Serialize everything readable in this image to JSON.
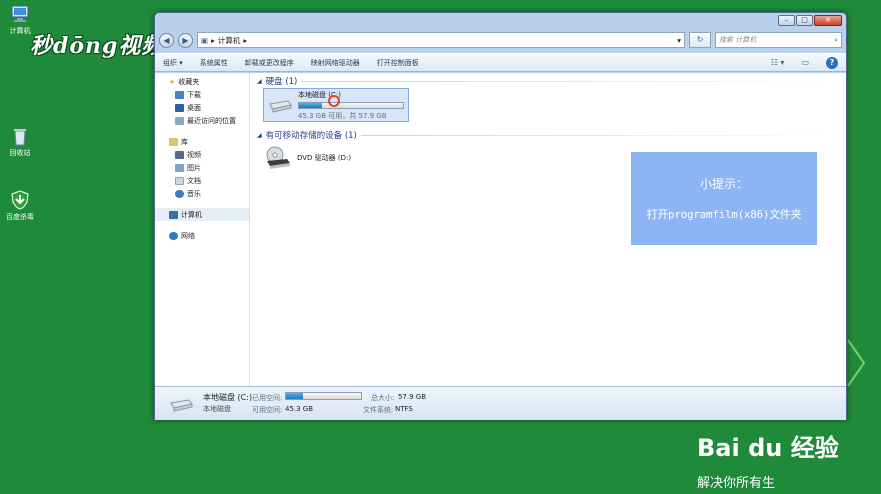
{
  "desktop": {
    "icons": [
      {
        "label": "计算机",
        "icon": "computer-icon"
      },
      {
        "label": "回收站",
        "icon": "recycle-bin-icon"
      },
      {
        "label": "百度杀毒",
        "icon": "antivirus-shield-icon"
      }
    ],
    "watermark": "秒dōng视频",
    "baidu_logo": "Bai du 经验",
    "baidu_slogan": "解决你所有生"
  },
  "window": {
    "buttons": {
      "minimize": "–",
      "maximize": "□",
      "close": "✕"
    },
    "nav": {
      "back": "◀",
      "forward": "▶"
    },
    "address": {
      "computer_icon": "computer-icon",
      "sep1": "▸",
      "path": "计算机",
      "sep2": "▸",
      "dropdown": "▾"
    },
    "refresh": "↻",
    "search": {
      "placeholder": "搜索 计算机",
      "icon": "search-icon"
    },
    "toolbar": {
      "items": [
        "组织 ▾",
        "系统属性",
        "卸载或更改程序",
        "映射网络驱动器",
        "打开控制面板"
      ],
      "right_icons": [
        "view-options-icon",
        "preview-pane-icon",
        "help-icon"
      ],
      "view": "☷ ▾",
      "preview": "▭",
      "help": "?"
    },
    "sidebar": {
      "favorites": {
        "label": "收藏夹",
        "items": [
          "下载",
          "桌面",
          "最近访问的位置"
        ]
      },
      "libraries": {
        "label": "库",
        "items": [
          "视频",
          "图片",
          "文档",
          "音乐"
        ]
      },
      "computer": "计算机",
      "network": "网络"
    },
    "content": {
      "hard_disks": {
        "title": "硬盘 (1)"
      },
      "drive_c": {
        "name": "本地磁盘 (C:)",
        "space": "45.3 GB 可用，共 57.9 GB",
        "used_fraction": 0.22
      },
      "removable": {
        "title": "有可移动存储的设备 (1)"
      },
      "drive_d": {
        "name": "DVD 驱动器 (D:)"
      }
    },
    "tip": {
      "title": "小提示：",
      "text": "打开programfilm(x86)文件夹"
    },
    "details": {
      "name": "本地磁盘 (C:)",
      "type": "本地磁盘",
      "used_label": "已用空间:",
      "free_label": "可用空间:",
      "free_value": "45.3 GB",
      "total_label": "总大小:",
      "total_value": "57.9 GB",
      "fs_label": "文件系统:",
      "fs_value": "NTFS",
      "used_fraction": 0.22
    },
    "colors": {
      "accent": "#1a78c2",
      "tip": "#8db4f4",
      "desktop": "#1f8a3a"
    }
  }
}
